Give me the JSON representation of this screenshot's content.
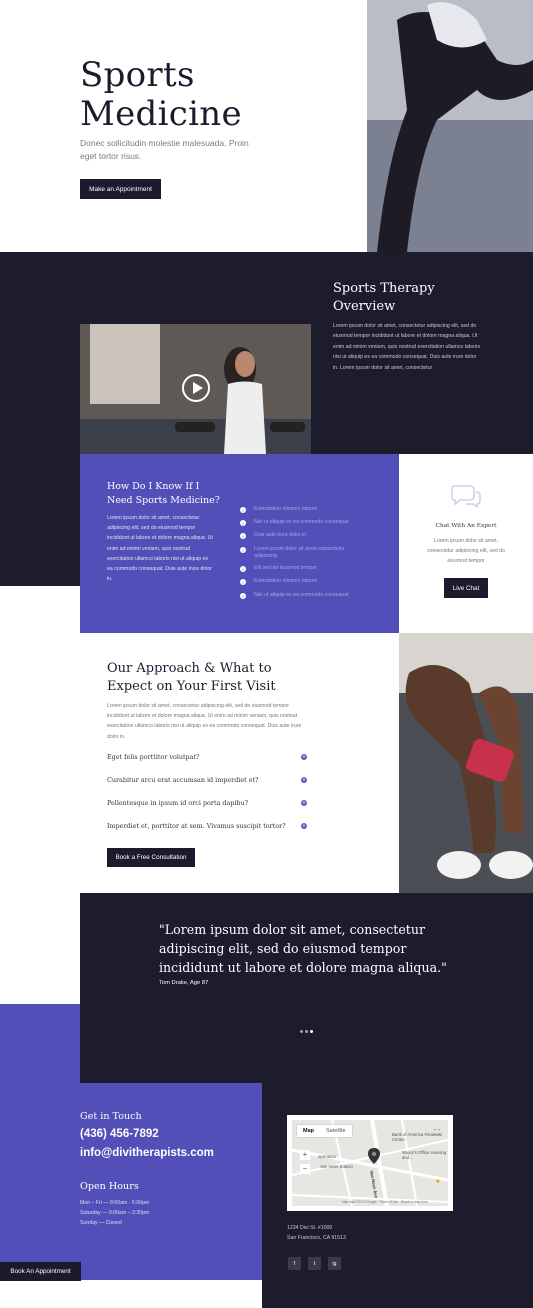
{
  "hero": {
    "title": "Sports\nMedicine",
    "subtitle": "Donec sollicitudin molestie malesuada. Proin eget tortor risus.",
    "button_label": "Make an Appointment"
  },
  "overview": {
    "title": "Sports Therapy\nOverview",
    "text": "Lorem ipsum dolor sit amet, consectetur adipiscing elit, sed do eiusmod tempor incididunt ut labore et dolore magna aliqua. Ut enim ad minim veniam, quis nostrud exercitation ullamco laboris nisi ut aliquip ex ea commodo consequat. Duis aute irure dolor in. Lorem ipsum dolor sit amet, consectetur"
  },
  "know": {
    "title": "How Do I Know If I Need Sports Medicine?",
    "text": "Lorem ipsum dolor sit amet, consectetur adipiscing elit, sed do eiusmod tempor incididunt ut labore et dolore magna aliqua. Ut enim ad minim veniam, quis nostrud exercitation ullamco laboris nisi ut aliquip ex ea commodo consequat. Duis aute irure dolor in.",
    "checklist": [
      "Exercitation ullamco laboris",
      "Nisi ut aliquip ex ea commodo consequat",
      "Duis aute irure dolor in",
      "Lorem ipsum dolor sit amet consectetur adipiscing",
      "Elit sed do eiusmod tempor",
      "Exercitation ullamco laboris",
      "Nisi ut aliquip ex ea commodo consequat"
    ]
  },
  "chat": {
    "title": "Chat With An Expert",
    "text": "Lorem ipsum dolor sit amet, consectetur adipiscing elit, sed do eiusmod tempor",
    "button_label": "Live Chat"
  },
  "approach": {
    "title": "Our Approach & What to Expect on Your First Visit",
    "text": "Lorem ipsum dolor sit amet, consectetur adipiscing elit, sed do eiusmod tempor incididunt ut labore et dolore magna aliqua. Ut enim ad minim veniam, quis nostrud exercitation ullamco laboris nisi ut aliquip ex ea commodo consequat. Duis aute irure dolor in.",
    "faqs": [
      "Eget felis porttitor volutpat?",
      "Curabitur arcu erat accumsan id imperdiet et?",
      "Pellentesque in ipsum id orci porta dapibu?",
      "Imperdiet et, porttitor at sem. Vivamus suscipit tortor?"
    ],
    "button_label": "Book a Free Consultation"
  },
  "quote": {
    "text": "\"Lorem ipsum dolor sit amet, consectetur adipiscing elit, sed do eiusmod tempor incididunt ut labore et dolore magna aliqua.\"",
    "author": "Tom Drake, Age 87"
  },
  "contact": {
    "touch_title": "Get in Touch",
    "phone": "(436) 456-7892",
    "email": "info@divitherapists.com",
    "hours_title": "Open Hours",
    "hours": [
      "Mon – Fri — 8:00am - 5:00pm",
      "Saturday — 9:00am – 3:30pm",
      "Sunday — Closed"
    ],
    "book_label": "Book An Appointment",
    "address_line1": "1234 Divi St. #1000",
    "address_line2": "San Francisco, CA 91513"
  },
  "map": {
    "tabs": [
      "Map",
      "Satellite"
    ],
    "labels": [
      "Bank of America Financial Center",
      "Mayor's Office Housing and...",
      "Van Ness Station",
      "Van Ness Ave",
      "operation"
    ],
    "footer": "Map data ©2019 Google   Terms of Use   Report a map error"
  },
  "social": [
    "f",
    "t",
    "ig"
  ],
  "colors": {
    "dark": "#1d1c2d",
    "purple": "#5250b8",
    "accent": "#5f5dc8"
  }
}
